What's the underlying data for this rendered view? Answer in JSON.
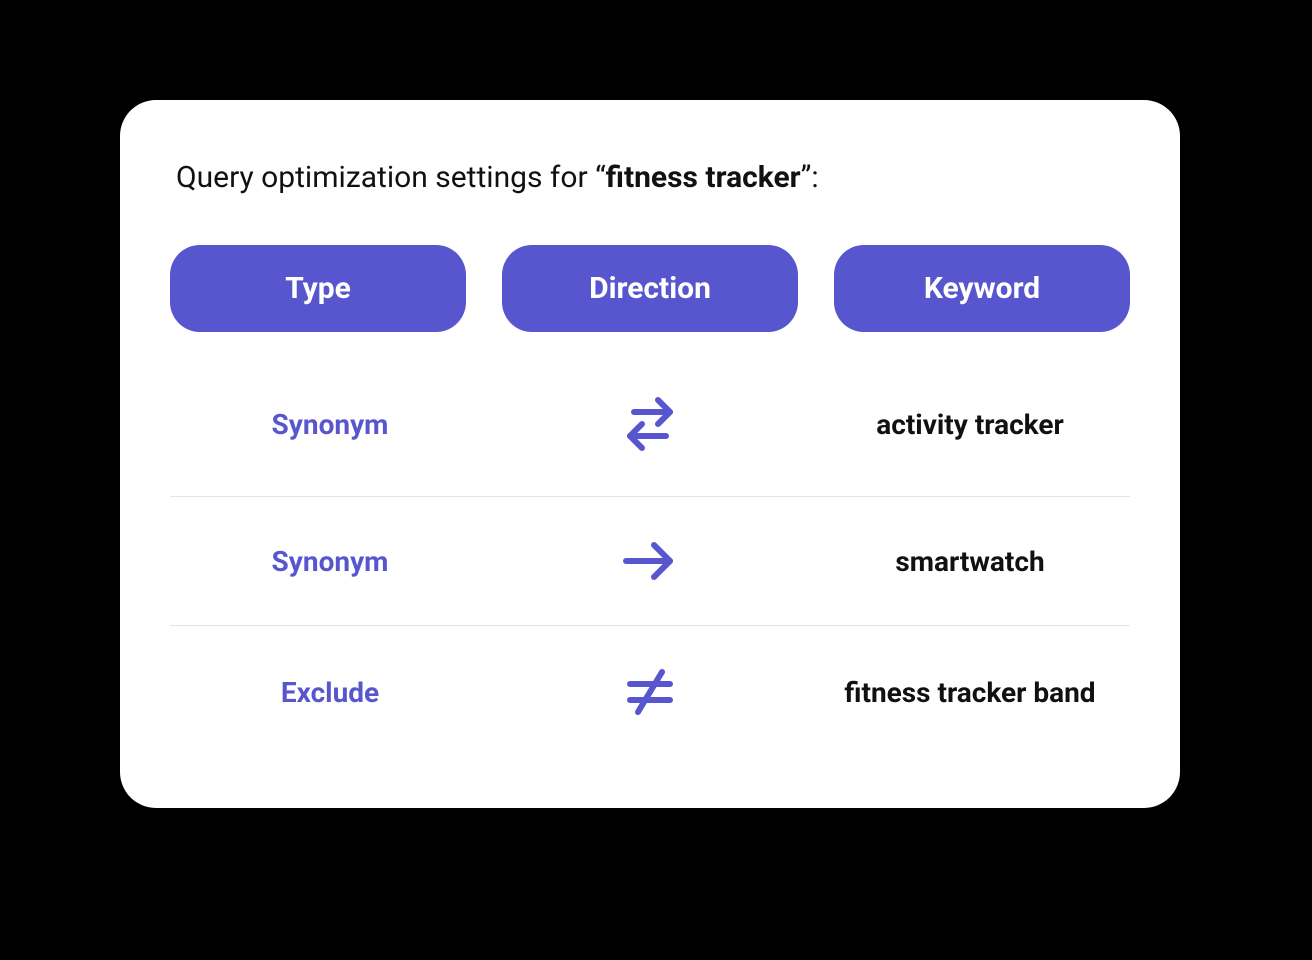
{
  "title": {
    "prefix": "Query optimization settings for ",
    "quote_open": "“",
    "term": "fitness tracker",
    "quote_close": "”",
    "suffix": ":"
  },
  "headers": {
    "type": "Type",
    "direction": "Direction",
    "keyword": "Keyword"
  },
  "rows": [
    {
      "type": "Synonym",
      "direction": "bidirectional",
      "keyword": "activity tracker"
    },
    {
      "type": "Synonym",
      "direction": "right",
      "keyword": "smartwatch"
    },
    {
      "type": "Exclude",
      "direction": "notequal",
      "keyword": "fitness tracker band"
    }
  ],
  "colors": {
    "accent": "#5856ce"
  }
}
